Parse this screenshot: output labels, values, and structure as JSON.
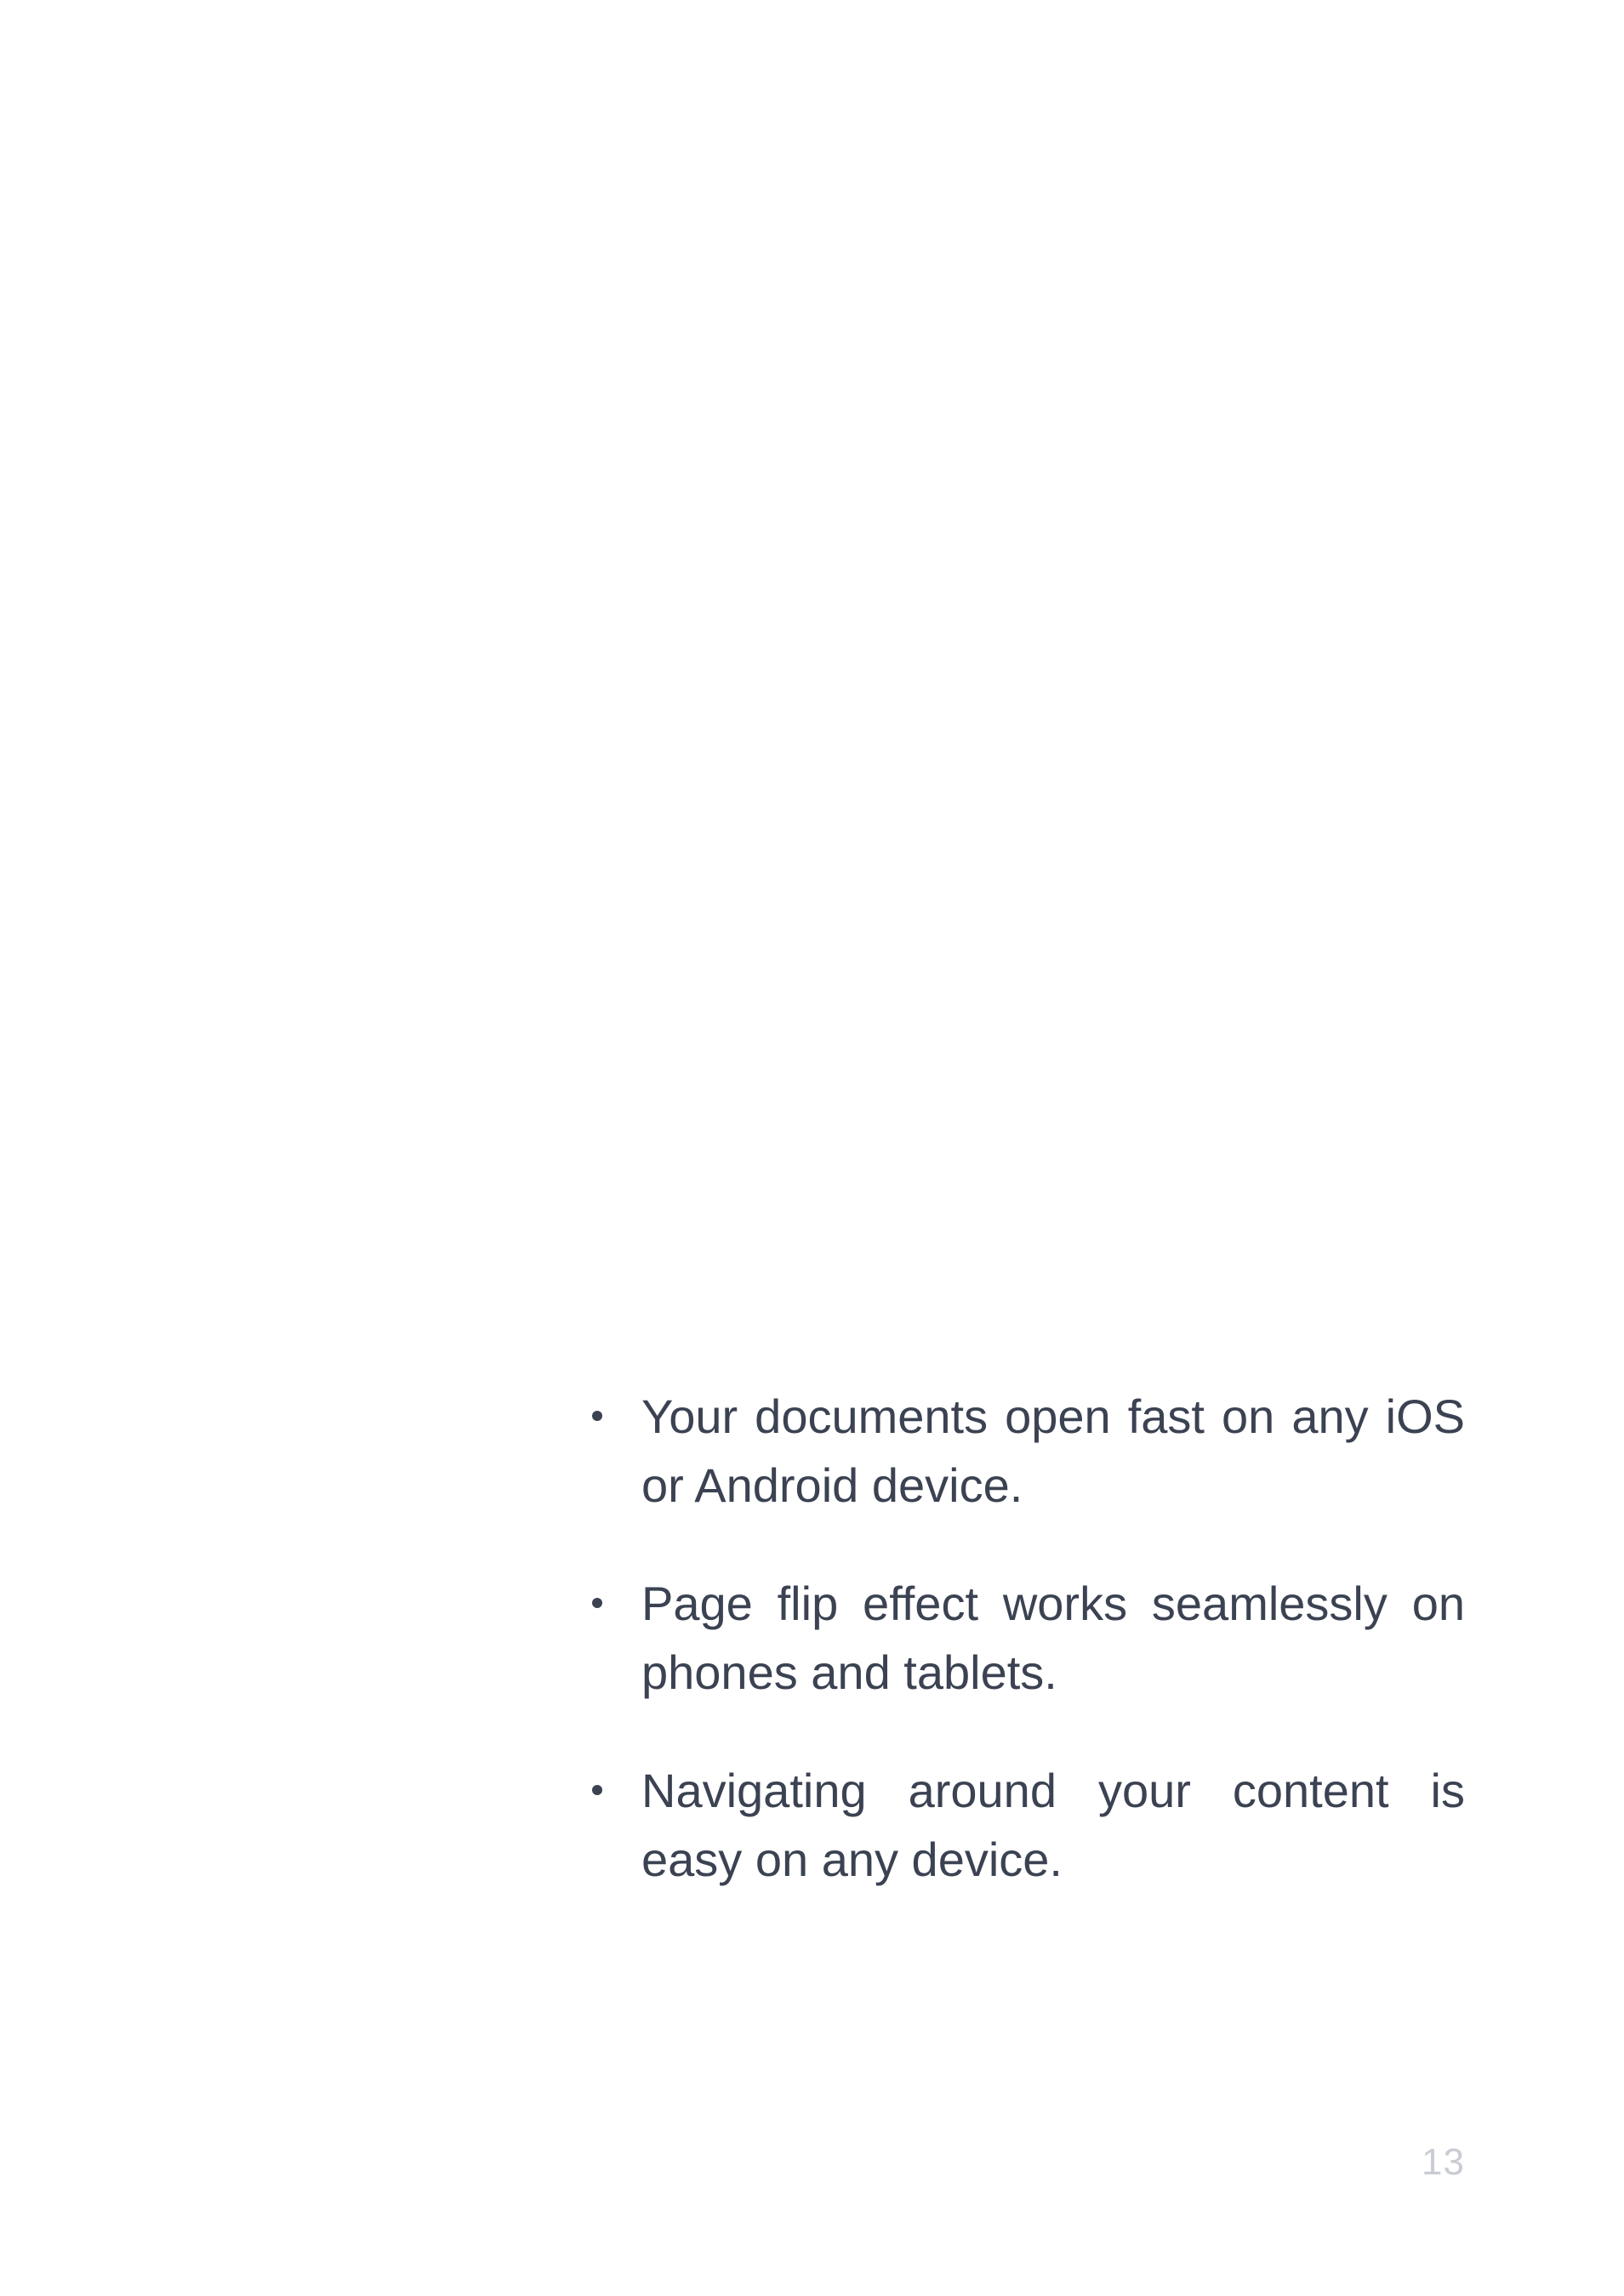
{
  "document": {
    "bullets": [
      {
        "text": "Your documents open fast on any iOS or Android device."
      },
      {
        "text": "Page flip effect works seamlessly on phones and tablets."
      },
      {
        "text": "Navigating around your content is easy on any device."
      }
    ],
    "page_number": "13"
  },
  "colors": {
    "background": "#ffffff",
    "body_text": "#3b4252",
    "page_number": "#c9ccd3"
  }
}
